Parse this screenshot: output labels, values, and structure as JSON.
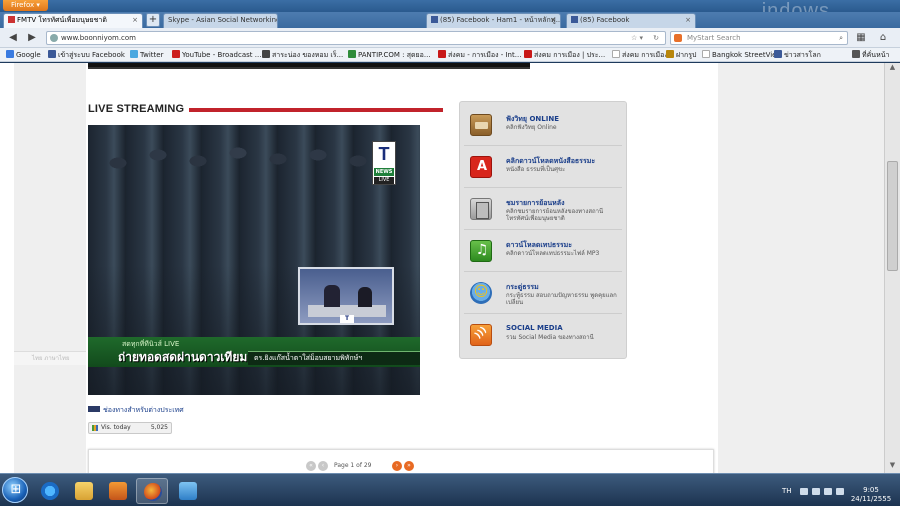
{
  "browser": {
    "app_button": "Firefox",
    "watermark": "indows",
    "tabs": [
      {
        "label": "FMTV โทรทัศน์เพื่อมนุษยชาติ",
        "active": true
      },
      {
        "label": "Skype - Asian Social Networking Ser...",
        "active": false
      },
      {
        "label": "(85) Facebook - Ham1 - หน้าหลักฟู...",
        "active": false
      },
      {
        "label": "(85) Facebook",
        "active": false
      }
    ],
    "new_tab": "+",
    "url": "www.boonniyom.com",
    "search_placeholder": "MyStart Search"
  },
  "bookmarks": [
    {
      "label": "Google",
      "color": "#3a7be0"
    },
    {
      "label": "เข้าสู่ระบบ Facebook",
      "color": "#3b5998"
    },
    {
      "label": "Twitter",
      "color": "#4aa8e0"
    },
    {
      "label": "YouTube - Broadcast ...",
      "color": "#cc1f1f"
    },
    {
      "label": "สาระน่อง ของหอม เร็...",
      "color": "#444444"
    },
    {
      "label": "PANTIP.COM : สุดยอ...",
      "color": "#2e8b3a"
    },
    {
      "label": "ส่งคม - การเมือง - Int...",
      "color": "#c81818"
    },
    {
      "label": "ส่งคม การเมือง | ประ...",
      "color": "#c81818"
    },
    {
      "label": "ส่งคม การเมือง",
      "color": "#cccccc"
    },
    {
      "label": "ฝากรูป",
      "color": "#b8860b"
    },
    {
      "label": "Bangkok StreetView",
      "color": "#cccccc"
    },
    {
      "label": "ข่าวสารโลก",
      "color": "#3b5998"
    },
    {
      "label": "ที่คั่นหน้า",
      "color": "#555555"
    }
  ],
  "page": {
    "ghost_label": "ไทย ภาษาไทย",
    "section_title": "LIVE STREAMING",
    "video": {
      "green_small": "สดทุกที่ทีนิวส์ LIVE",
      "green_big": "ถ่ายทอดสดผ่านดาวเทียม",
      "ticker": "ตร.ยิงแก๊สน้ำตาใส่ม็อบสยามพิทักษ์ฯ"
    },
    "channel_link": "ช่องทางสำหรับต่างประเทศ",
    "stats": {
      "label": "Vis. today",
      "value": "5,025"
    },
    "pager": {
      "text": "Page 1 of 29",
      "prev": "‹",
      "first": "«",
      "next": "›",
      "last": "»"
    }
  },
  "sidebar": {
    "items": [
      {
        "title": "ฟังวิทยุ ONLINE",
        "desc": "คลิกฟังวิทยุ Online",
        "icon": "radio-icon"
      },
      {
        "title": "คลิกดาวน์โหลดหนังสือธรรมะ",
        "desc": "หนังสือ ธรรมที่เป็นศุขะ",
        "icon": "pdf-icon"
      },
      {
        "title": "ชมรายการย้อนหลัง",
        "desc": "คลิกชมรายการย้อนหลังของทางสถานีโทรทัศน์เพื่อมนุษยชาติ",
        "icon": "film-icon"
      },
      {
        "title": "ดาวน์โหลดเทปธรรมะ",
        "desc": "คลิกดาวน์โหลดเทปธรรมะไฟล์ MP3",
        "icon": "music-icon"
      },
      {
        "title": "กระดู่ธรรม",
        "desc": "กระทู้ธรรม สอบถามปัญหาธรรม พูดคุยแลกเปลี่ยน",
        "icon": "chat-icon"
      },
      {
        "title": "SOCIAL MEDIA",
        "desc": "รวม Social Media ของทางสถานี",
        "icon": "rss-icon"
      }
    ]
  },
  "taskbar": {
    "lang": "TH",
    "time": "9:05",
    "date": "24/11/2555"
  }
}
